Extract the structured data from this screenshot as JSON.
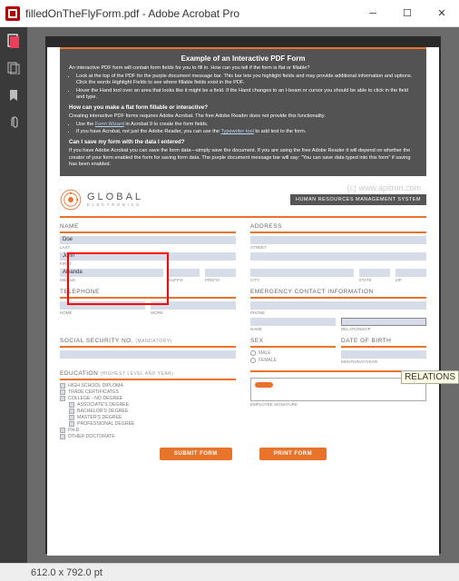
{
  "window": {
    "title": "filledOnTheFlyForm.pdf - Adobe Acrobat Pro"
  },
  "header": {
    "title": "Example of an Interactive PDF Form",
    "intro": "An interactive PDF form will contain form fields for you to fill in. How can you tell if the form is flat or fillable?",
    "bullets1": [
      "Look at the top of the PDF for the purple document message bar. This bar lets you highlight fields and may provide additional information and options. Click the words Highlight Fields to see where fillable fields exist in the PDF.",
      "Hover the Hand tool over an area that looks like it might be a field. If the Hand changes to an I-beam or cursor you should be able to click in the field and type."
    ],
    "q2": "How can you make a flat form fillable or interactive?",
    "q2text": "Creating interactive PDF forms requires Adobe Acrobat. The free Adobe Reader does not provide this functionality.",
    "bullets2_a": "Use the ",
    "bullets2_a_link": "Form Wizard",
    "bullets2_a_tail": " in Acrobat 9 to create the form fields.",
    "bullets2_b": "If you have Acrobat, not just the Adobe Reader, you can use the ",
    "bullets2_b_link": "Typewriter tool",
    "bullets2_b_tail": " to add text to the form.",
    "q3": "Can I save my form with the data I entered?",
    "q3text": "If you have Adobe Acrobat you can save the form data—simply save the document. If you are using the free Adobe Reader it will depend on whether the creator of your form enabled the form for saving form data. The purple document message bar will say: \"You can save data typed into this form\" if saving has been enabled."
  },
  "watermark": "(c) www.apitron.com",
  "brand": {
    "main": "GLOBAL",
    "sub": "ELECTRONICS",
    "tag": "HUMAN RESOURCES MANAGEMENT SYSTEM"
  },
  "sections": {
    "name": "NAME",
    "address": "ADDRESS",
    "telephone": "TELEPHONE",
    "emergency": "EMERGENCY CONTACT INFORMATION",
    "ssn": "SOCIAL SECURITY NO.",
    "ssn_note": "(MANDATORY)",
    "sex": "SEX",
    "dob": "DATE OF BIRTH",
    "education": "EDUCATION",
    "edu_note": "(HIGHEST LEVEL AND YEAR)"
  },
  "labels": {
    "last": "LAST",
    "first": "FIRST",
    "middle": "MIDDLE",
    "suffix": "SUFFIX",
    "prefix": "PREFIX",
    "street": "STREET",
    "city": "CITY",
    "state": "STATE",
    "zip": "ZIP",
    "home": "HOME",
    "work": "WORK",
    "phone": "PHONE",
    "name_l": "NAME",
    "relationship": "RELATIONSHIP",
    "male": "MALE",
    "female": "FEMALE",
    "dobfmt": "MONTH/DAY/YEAR",
    "empsig": "EMPLOYEE SIGNATURE"
  },
  "values": {
    "last": "Doe",
    "first": "John",
    "middle": "Alvanda"
  },
  "education": {
    "hs": "HIGH SCHOOL DIPLOMA",
    "trade": "TRADE CERTIFICATES",
    "college": "COLLEGE - NO DEGREE",
    "assoc": "ASSOCIATE'S DEGREE",
    "bach": "BACHELOR'S DEGREE",
    "mast": "MASTER'S DEGREE",
    "prof": "PROFESSIONAL DEGREE",
    "phd": "PH.D.",
    "other": "OTHER DOCTORATE"
  },
  "buttons": {
    "submit": "SUBMIT FORM",
    "print": "PRINT FORM"
  },
  "status": "612.0 x 792.0 pt",
  "tooltip": "RELATIONS"
}
